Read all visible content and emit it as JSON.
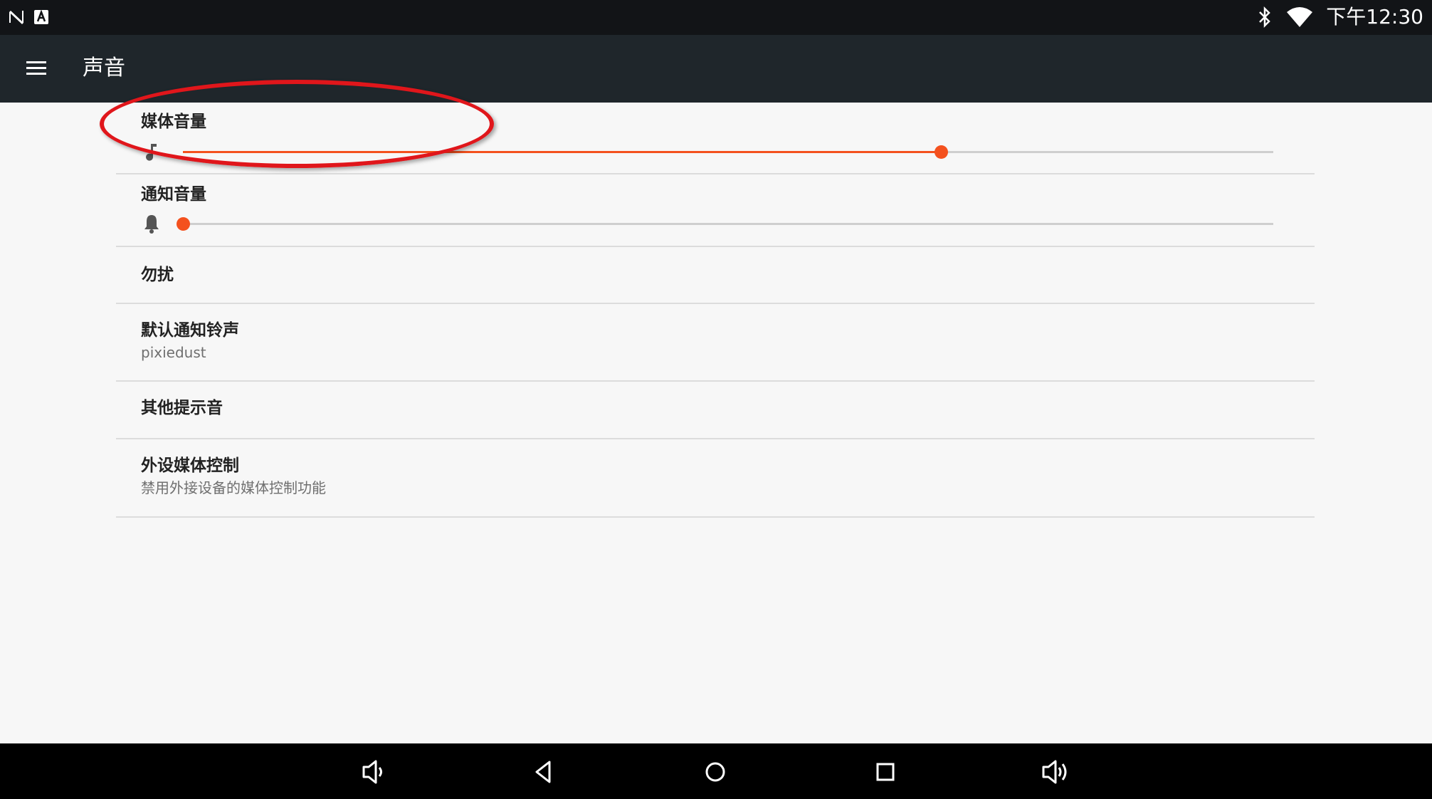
{
  "status_bar": {
    "time": "下午12:30",
    "left_icons": [
      "n-notification-icon",
      "a-notification-icon"
    ],
    "right_icons": [
      "bluetooth-icon",
      "wifi-icon"
    ]
  },
  "app_bar": {
    "title": "声音",
    "menu_icon": "hamburger-menu-icon"
  },
  "settings": {
    "media_volume": {
      "title": "媒体音量",
      "icon": "music-note-icon",
      "level": 0.695
    },
    "notification_volume": {
      "title": "通知音量",
      "icon": "bell-icon",
      "level": 0.0
    },
    "dnd": {
      "title": "勿扰"
    },
    "default_ringtone": {
      "title": "默认通知铃声",
      "subtitle": "pixiedust"
    },
    "other_sounds": {
      "title": "其他提示音"
    },
    "media_controls": {
      "title": "外设媒体控制",
      "subtitle": "禁用外接设备的媒体控制功能"
    }
  },
  "nav_bar": {
    "items": [
      "volume-down-icon",
      "back-icon",
      "home-icon",
      "recents-icon",
      "volume-up-icon"
    ]
  },
  "colors": {
    "accent": "#f4511e",
    "app_bar": "#1f262b",
    "status_bar": "#121417",
    "annotation": "#e0161b"
  }
}
